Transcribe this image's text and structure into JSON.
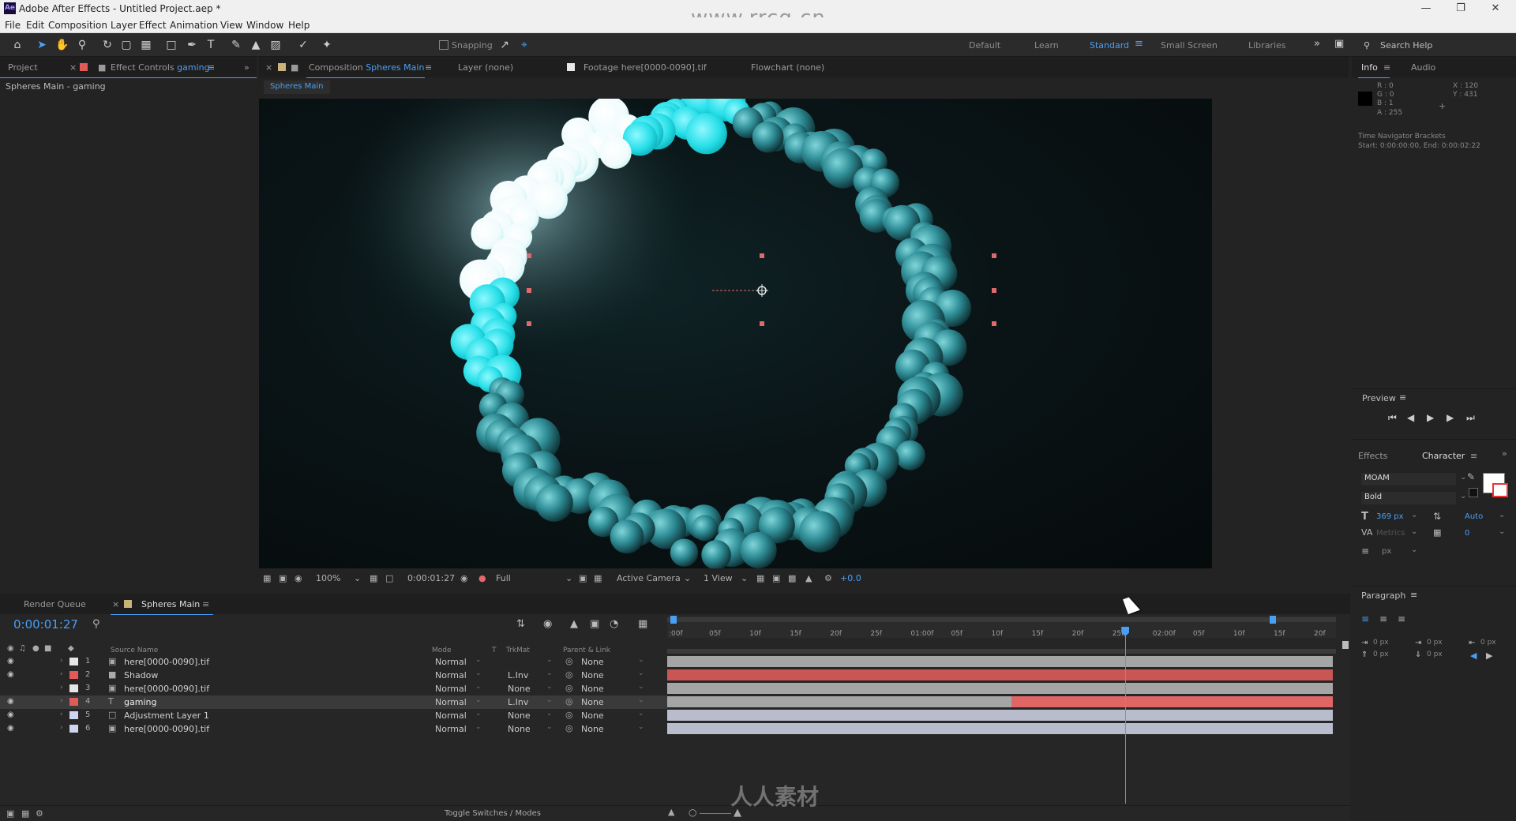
{
  "watermark_top": "www.rrcg.cn",
  "window": {
    "title": "Adobe After Effects - Untitled Project.aep *",
    "app_icon": "Ae"
  },
  "menu": [
    "File",
    "Edit",
    "Composition",
    "Layer",
    "Effect",
    "Animation",
    "View",
    "Window",
    "Help"
  ],
  "workspaces": {
    "items": [
      "Default",
      "Learn",
      "Standard",
      "Small Screen",
      "Libraries"
    ],
    "active": "Standard",
    "search": "Search Help"
  },
  "toolbar": {
    "snapping": "Snapping"
  },
  "left_panel": {
    "tab_project": "Project",
    "tab_effect_controls": "Effect Controls",
    "tab_effect_controls_layer": "gaming",
    "subtitle": "Spheres Main - gaming"
  },
  "comp_panel": {
    "tab_composition": "Composition",
    "comp_name": "Spheres Main",
    "tab_layer": "Layer (none)",
    "tab_footage": "Footage here[0000-0090].tif",
    "tab_flowchart": "Flowchart (none)",
    "breadcrumb": "Spheres Main"
  },
  "viewer_controls": {
    "zoom": "100%",
    "timecode": "0:00:01:27",
    "resolution": "Full",
    "camera": "Active Camera",
    "views": "1 View",
    "exposure": "+0.0"
  },
  "info_panel": {
    "tab_info": "Info",
    "tab_audio": "Audio",
    "r": "R : 0",
    "g": "G : 0",
    "b": "B : 1",
    "a": "A : 255",
    "x": "X : 120",
    "y": "Y : 431",
    "nav_title": "Time Navigator Brackets",
    "nav_range": "Start: 0:00:00:00, End: 0:00:02:22"
  },
  "preview_panel": {
    "title": "Preview"
  },
  "character_panel": {
    "tab_effects": "Effects",
    "title": "Character",
    "font": "MOAM",
    "style": "Bold",
    "size": "369 px",
    "leading": "Auto",
    "kerning": "Metrics",
    "tracking": "0",
    "stroke_unit": "px"
  },
  "paragraph_panel": {
    "title": "Paragraph",
    "indent_left": "0 px",
    "indent_first": "0 px",
    "indent_right": "0 px",
    "space_before": "0 px",
    "space_after": "0 px"
  },
  "timeline": {
    "tab_render_queue": "Render Queue",
    "tab_comp": "Spheres Main",
    "current_time": "0:00:01:27",
    "toggle_label": "Toggle Switches / Modes",
    "columns": {
      "source_name": "Source Name",
      "mode": "Mode",
      "t": "T",
      "trkmat": "TrkMat",
      "parent": "Parent & Link"
    },
    "ticks": [
      ":00f",
      "05f",
      "10f",
      "15f",
      "20f",
      "25f",
      "01:00f",
      "05f",
      "10f",
      "15f",
      "20f",
      "25f",
      "02:00f",
      "05f",
      "10f",
      "15f",
      "20f"
    ],
    "layers": [
      {
        "num": "1",
        "name": "here[0000-0090].tif",
        "color": "#e6e6e6",
        "type": "footage",
        "mode": "Normal",
        "trkmat": "",
        "parent": "None",
        "bar_color": "#a5a5a5",
        "selected": false,
        "visible": true
      },
      {
        "num": "2",
        "name": "Shadow",
        "color": "#e05a5a",
        "type": "solid",
        "mode": "Normal",
        "trkmat": "L.Inv",
        "parent": "None",
        "bar_color": "#c95555",
        "selected": false,
        "visible": true
      },
      {
        "num": "3",
        "name": "here[0000-0090].tif",
        "color": "#e6e6e6",
        "type": "footage",
        "mode": "Normal",
        "trkmat": "None",
        "parent": "None",
        "bar_color": "#a5a5a5",
        "selected": false,
        "visible": false
      },
      {
        "num": "4",
        "name": "gaming",
        "color": "#e05a5a",
        "type": "text",
        "mode": "Normal",
        "trkmat": "L.Inv",
        "parent": "None",
        "bar_color": "#e06666",
        "selected": true,
        "visible": true
      },
      {
        "num": "5",
        "name": "Adjustment Layer 1",
        "color": "#cfd4f0",
        "type": "adjust",
        "mode": "Normal",
        "trkmat": "None",
        "parent": "None",
        "bar_color": "#b8bccc",
        "selected": false,
        "visible": true
      },
      {
        "num": "6",
        "name": "here[0000-0090].tif",
        "color": "#cfd4f0",
        "type": "footage",
        "mode": "Normal",
        "trkmat": "None",
        "parent": "None",
        "bar_color": "#b8bccc",
        "selected": false,
        "visible": true
      }
    ],
    "playhead_position": 0.685,
    "layer4_in_point": 0.515
  },
  "watermark_bottom": "人人素材"
}
